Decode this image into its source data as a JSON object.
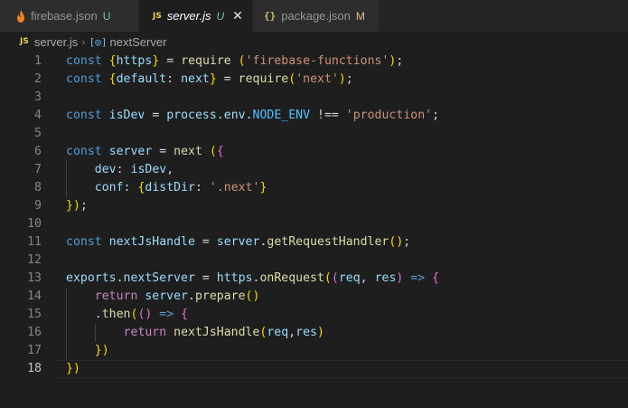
{
  "tabs": [
    {
      "icon": "firebase-icon",
      "name": "firebase.json",
      "status": "U",
      "active": false
    },
    {
      "icon": "js-icon",
      "icon_text": "JS",
      "name": "server.js",
      "status": "U",
      "active": true,
      "close_glyph": "✕"
    },
    {
      "icon": "json-braces-icon",
      "icon_text": "{}",
      "name": "package.json",
      "status": "M",
      "active": false
    }
  ],
  "breadcrumb": {
    "file_icon_text": "JS",
    "file": "server.js",
    "separator": "›",
    "symbol_icon_text": "[◎]",
    "symbol": "nextServer"
  },
  "editor": {
    "current_line": 18,
    "lines": [
      {
        "n": "1",
        "t": "const {https} = require ('firebase-functions');"
      },
      {
        "n": "2",
        "t": "const {default: next} = require('next');"
      },
      {
        "n": "3",
        "t": ""
      },
      {
        "n": "4",
        "t": "const isDev = process.env.NODE_ENV !== 'production';"
      },
      {
        "n": "5",
        "t": ""
      },
      {
        "n": "6",
        "t": "const server = next ({"
      },
      {
        "n": "7",
        "t": "    dev: isDev,"
      },
      {
        "n": "8",
        "t": "    conf: {distDir: '.next'}"
      },
      {
        "n": "9",
        "t": "});"
      },
      {
        "n": "10",
        "t": ""
      },
      {
        "n": "11",
        "t": "const nextJsHandle = server.getRequestHandler();"
      },
      {
        "n": "12",
        "t": ""
      },
      {
        "n": "13",
        "t": "exports.nextServer = https.onRequest((req, res) => {"
      },
      {
        "n": "14",
        "t": "    return server.prepare()"
      },
      {
        "n": "15",
        "t": "    .then(() => {"
      },
      {
        "n": "16",
        "t": "        return nextJsHandle(req,res)"
      },
      {
        "n": "17",
        "t": "    })"
      },
      {
        "n": "18",
        "t": "})"
      }
    ]
  },
  "colors": {
    "background": "#1e1e1e",
    "keyword": "#569cd6",
    "control_keyword": "#c586c0",
    "function": "#dcdcaa",
    "string": "#ce9178",
    "variable": "#9cdcfe",
    "constant": "#4fc1ff",
    "bracket_level1": "#ffd700",
    "bracket_level2": "#da70d6",
    "bracket_level3": "#179fff",
    "git_untracked": "#73c991",
    "git_modified": "#e2c08d"
  }
}
